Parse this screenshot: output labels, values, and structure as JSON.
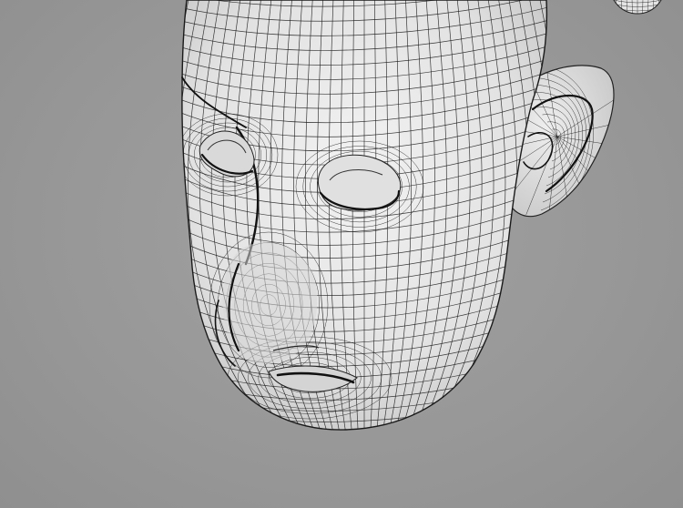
{
  "viewport": {
    "background_color": "#979797",
    "mesh_surface_color": "#e6e6e6",
    "wire_color": "#1b1b1b",
    "view": "perspective-3d"
  },
  "model": {
    "name": "head-wireframe",
    "parts": [
      "cranium",
      "ear",
      "brow",
      "eye-left",
      "eye-right",
      "nose",
      "mouth",
      "chin"
    ]
  },
  "icons": {
    "corner_object": "partial-sphere-icon"
  }
}
